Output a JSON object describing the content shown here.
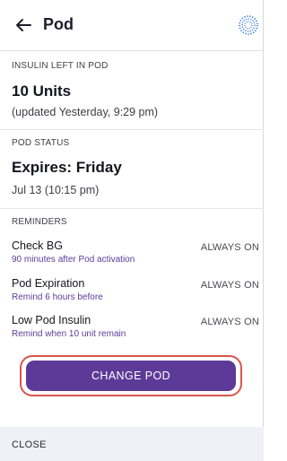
{
  "header": {
    "title": "Pod",
    "back_icon": "arrow-left-icon",
    "pod_icon": "pod-dotted-circle-icon"
  },
  "insulin": {
    "label": "INSULIN LEFT IN POD",
    "value": "10 Units",
    "updated": "(updated Yesterday, 9:29 pm)"
  },
  "status": {
    "label": "POD STATUS",
    "value": "Expires: Friday",
    "date": "Jul 13 (10:15 pm)"
  },
  "reminders": {
    "label": "REMINDERS",
    "items": [
      {
        "title": "Check BG",
        "desc": "90 minutes after Pod activation",
        "state": "ALWAYS ON"
      },
      {
        "title": "Pod Expiration",
        "desc": "Remind 6 hours before",
        "state": "ALWAYS ON"
      },
      {
        "title": "Low Pod Insulin",
        "desc": "Remind when 10 unit remain",
        "state": "ALWAYS ON"
      }
    ]
  },
  "actions": {
    "change_pod": "CHANGE POD",
    "close": "CLOSE"
  },
  "colors": {
    "accent": "#5d3a98",
    "highlight": "#d9554d",
    "icon_blue": "#3b7fd9"
  }
}
